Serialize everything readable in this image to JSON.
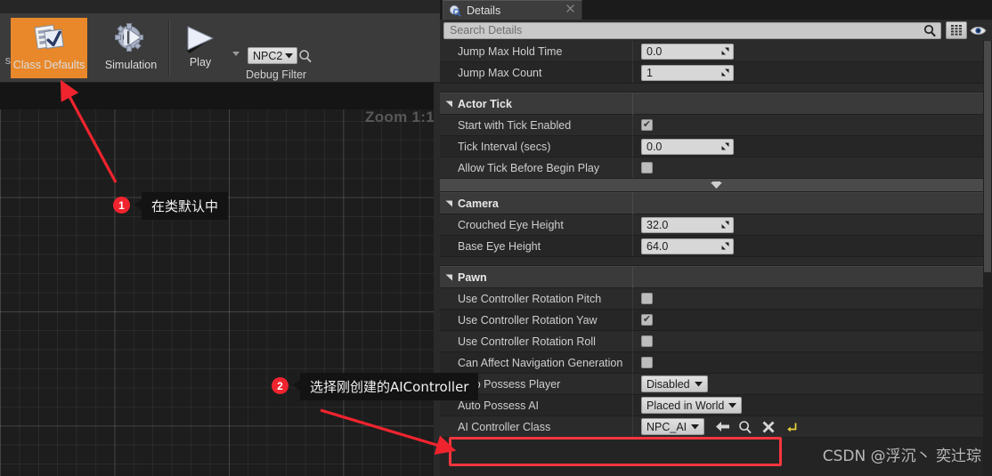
{
  "toolbar": {
    "prev_button_sliver": "s",
    "buttons": [
      {
        "label": "Class Defaults",
        "icon": "class-defaults-icon",
        "active": true
      },
      {
        "label": "Simulation",
        "icon": "simulation-gear-icon",
        "active": false
      }
    ],
    "play_label": "Play",
    "play_icon": "play-triangle-icon",
    "play_dropdown_icon": "chevron-down-icon",
    "debug_filter_value": "NPC2",
    "debug_filter_label": "Debug Filter",
    "debug_search_icon": "search-icon"
  },
  "graph": {
    "zoom_label": "Zoom 1:1"
  },
  "details": {
    "tab_label": "Details",
    "tab_icon": "details-info-icon",
    "tab_close_icon": "close-icon",
    "search_placeholder": "Search Details",
    "search_value": "",
    "search_icon": "search-icon",
    "grid_view_icon": "grid-settings-icon",
    "eye_icon": "eye-visibility-icon",
    "rows": [
      {
        "kind": "prop",
        "name": "Jump Max Hold Time",
        "control": "number",
        "value": "0.0",
        "shade": "dark"
      },
      {
        "kind": "prop",
        "name": "Jump Max Count",
        "control": "number",
        "value": "1",
        "shade": "darker"
      },
      {
        "kind": "sep"
      },
      {
        "kind": "header",
        "name": "Actor Tick"
      },
      {
        "kind": "prop",
        "name": "Start with Tick Enabled",
        "control": "checkbox",
        "checked": true,
        "shade": "dark"
      },
      {
        "kind": "prop",
        "name": "Tick Interval (secs)",
        "control": "number",
        "value": "0.0",
        "shade": "darker"
      },
      {
        "kind": "prop",
        "name": "Allow Tick Before Begin Play",
        "control": "checkbox",
        "checked": false,
        "shade": "dark"
      },
      {
        "kind": "expander",
        "icon": "expand-more-icon"
      },
      {
        "kind": "header",
        "name": "Camera"
      },
      {
        "kind": "prop",
        "name": "Crouched Eye Height",
        "control": "number",
        "value": "32.0",
        "shade": "dark"
      },
      {
        "kind": "prop",
        "name": "Base Eye Height",
        "control": "number",
        "value": "64.0",
        "shade": "darker"
      },
      {
        "kind": "sep"
      },
      {
        "kind": "header",
        "name": "Pawn"
      },
      {
        "kind": "prop",
        "name": "Use Controller Rotation Pitch",
        "control": "checkbox",
        "checked": false,
        "shade": "dark"
      },
      {
        "kind": "prop",
        "name": "Use Controller Rotation Yaw",
        "control": "checkbox",
        "checked": true,
        "shade": "darker"
      },
      {
        "kind": "prop",
        "name": "Use Controller Rotation Roll",
        "control": "checkbox",
        "checked": false,
        "shade": "dark"
      },
      {
        "kind": "prop",
        "name": "Can Affect Navigation Generation",
        "control": "checkbox",
        "checked": false,
        "shade": "darker"
      },
      {
        "kind": "prop",
        "name": "Auto Possess Player",
        "control": "combo",
        "value": "Disabled",
        "shade": "dark"
      },
      {
        "kind": "prop",
        "name": "Auto Possess AI",
        "control": "combo",
        "value": "Placed in World",
        "shade": "darker"
      },
      {
        "kind": "prop",
        "name": "AI Controller Class",
        "control": "asset",
        "value": "NPC_AI",
        "shade": "dark",
        "actions": [
          "browse-back-icon",
          "search-icon",
          "clear-x-icon",
          "reset-arrow-icon"
        ]
      }
    ]
  },
  "annotations": [
    {
      "number": "1",
      "text": "在类默认中"
    },
    {
      "number": "2",
      "text": "选择刚创建的AIController"
    }
  ],
  "watermark": "CSDN @浮沉丶 奕辻琮",
  "colors": {
    "accent_orange": "#e8882a",
    "callout_red": "#f0242e",
    "highlight_red": "#f5363f",
    "panel_bg": "#2b2b2b",
    "header_bg": "#3a3a3a"
  }
}
